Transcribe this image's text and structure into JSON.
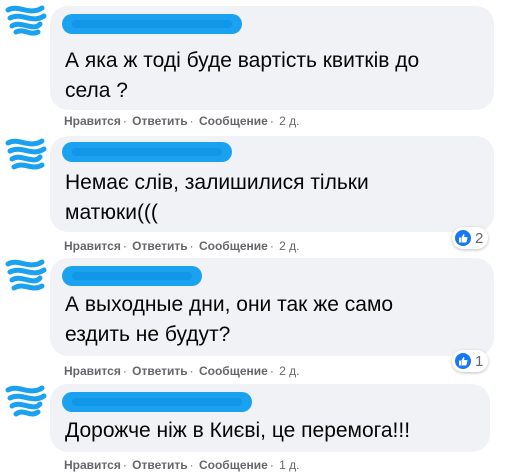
{
  "comments": [
    {
      "text_lines": [
        "А яка ж тоді буде вартість квитків до",
        "села ?"
      ],
      "actions": {
        "like": "Нравится",
        "reply": "Ответить",
        "message": "Сообщение",
        "time": "2 д."
      },
      "reaction_count": ""
    },
    {
      "text_lines": [
        "Немає слів, залишилися тільки",
        "матюки((("
      ],
      "actions": {
        "like": "Нравится",
        "reply": "Ответить",
        "message": "Сообщение",
        "time": "2 д."
      },
      "reaction_count": "2"
    },
    {
      "text_lines": [
        "А выходные дни, они так же само",
        "ездить не будут?"
      ],
      "actions": {
        "like": "Нравится",
        "reply": "Ответить",
        "message": "Сообщение",
        "time": "2 д."
      },
      "reaction_count": "1"
    },
    {
      "text_lines": [
        "Дорожче ніж в Києві, це перемога!!!"
      ],
      "actions": {
        "like": "Нравится",
        "reply": "Ответить",
        "message": "Сообщение",
        "time": "1 д."
      },
      "reaction_count": ""
    }
  ],
  "separator": "·",
  "icons": {
    "reaction": "like-icon",
    "redaction": "scribble"
  },
  "colors": {
    "bubble": "#f0f2f5",
    "redaction": "#1aa1f0",
    "meta": "#65676b",
    "like": "#1877f2"
  }
}
